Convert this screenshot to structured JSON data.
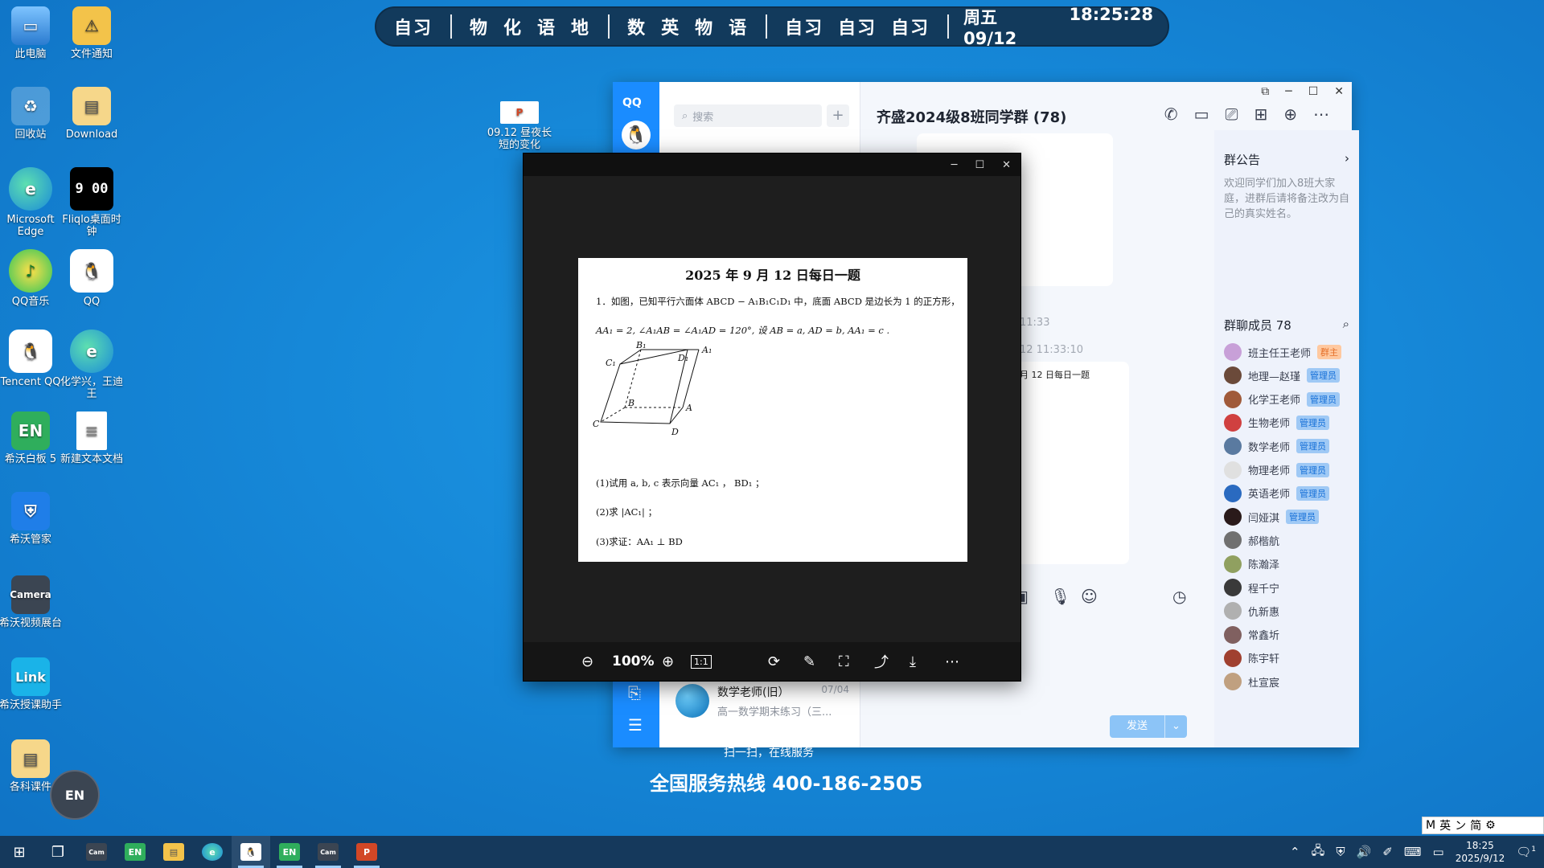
{
  "schedule": {
    "segments": [
      [
        "自习"
      ],
      [
        "物",
        "化",
        "语",
        "地"
      ],
      [
        "数",
        "英",
        "物",
        "语"
      ],
      [
        "自习",
        "自习",
        "自习"
      ]
    ],
    "weekday_date": "周五 09/12",
    "time": "18:25:28"
  },
  "desktop": {
    "icons": [
      {
        "label": "此电脑",
        "icon": "computer-icon"
      },
      {
        "label": "文件通知",
        "icon": "folder-warning-icon"
      },
      {
        "label": "回收站",
        "icon": "recycle-bin-icon"
      },
      {
        "label": "Download",
        "icon": "folder-icon"
      },
      {
        "label": "Microsoft Edge",
        "icon": "edge-icon"
      },
      {
        "label": "Fliqlo桌面时钟",
        "icon": "clock-icon"
      },
      {
        "label": "QQ音乐",
        "icon": "qq-music-icon"
      },
      {
        "label": "QQ",
        "icon": "qq-icon"
      },
      {
        "label": "Tencent QQ",
        "icon": "qq-icon"
      },
      {
        "label": "化学兴，王迪王",
        "icon": "edge-icon"
      },
      {
        "label": "希沃白板 5",
        "icon": "easinote-icon"
      },
      {
        "label": "新建文本文档",
        "icon": "text-document-icon"
      },
      {
        "label": "希沃管家",
        "icon": "shield-icon"
      },
      {
        "label": "希沃视频展台",
        "icon": "camera-icon"
      },
      {
        "label": "希沃授课助手",
        "icon": "link-icon"
      },
      {
        "label": "各科课件",
        "icon": "folder-icon"
      },
      {
        "label": "09.12 昼夜长短的变化",
        "icon": "ppt-icon"
      }
    ],
    "fliqlo_time": "9 00"
  },
  "qq": {
    "brand": "QQ",
    "search_placeholder": "搜索",
    "add_label": "+",
    "chat_list": [
      {
        "name": "数学老师(旧）",
        "time": "07/04",
        "preview": "高一数学期末练习（三..."
      }
    ],
    "chat_title": "齐盛2024级8班同学群 (78)",
    "timestamps": [
      "11:33",
      "12 11:33:10"
    ],
    "bubble_title": "月 12 日每日一题",
    "send_label": "发送",
    "group_notice_title": "群公告",
    "group_notice_text": "欢迎同学们加入8班大家庭，进群后请将备注改为自己的真实姓名。",
    "members_title": "群聊成员 78",
    "members": [
      {
        "name": "班主任王老师",
        "badge": "群主",
        "badge_type": "owner",
        "color": "#c8a0d8"
      },
      {
        "name": "地理—赵瑾",
        "badge": "管理员",
        "badge_type": "admin",
        "color": "#6b4a3a"
      },
      {
        "name": "化学王老师",
        "badge": "管理员",
        "badge_type": "admin",
        "color": "#a05a3a"
      },
      {
        "name": "生物老师",
        "badge": "管理员",
        "badge_type": "admin",
        "color": "#d04040"
      },
      {
        "name": "数学老师",
        "badge": "管理员",
        "badge_type": "admin",
        "color": "#5a7aa0"
      },
      {
        "name": "物理老师",
        "badge": "管理员",
        "badge_type": "admin",
        "color": "#e0e0e0"
      },
      {
        "name": "英语老师",
        "badge": "管理员",
        "badge_type": "admin",
        "color": "#2a6ac0"
      },
      {
        "name": "闫娅淇",
        "badge": "管理员",
        "badge_type": "admin",
        "color": "#2a1a1a"
      },
      {
        "name": "郝楷航",
        "badge": "",
        "badge_type": "",
        "color": "#707070"
      },
      {
        "name": "陈瀚泽",
        "badge": "",
        "badge_type": "",
        "color": "#90a060"
      },
      {
        "name": "程千宁",
        "badge": "",
        "badge_type": "",
        "color": "#3a3a3a"
      },
      {
        "name": "仇新惠",
        "badge": "",
        "badge_type": "",
        "color": "#b0b0b0"
      },
      {
        "name": "常鑫圻",
        "badge": "",
        "badge_type": "",
        "color": "#806060"
      },
      {
        "name": "陈宇轩",
        "badge": "",
        "badge_type": "",
        "color": "#a04030"
      },
      {
        "name": "杜宣宸",
        "badge": "",
        "badge_type": "",
        "color": "#c0a080"
      }
    ]
  },
  "viewer": {
    "zoom": "100%",
    "ratio_label": "1:1",
    "doc_title": "2025 年 9 月 12 日每日一题",
    "problem_line1": "1．如图，已知平行六面体 ABCD − A₁B₁C₁D₁ 中，底面 ABCD 是边长为 1 的正方形，",
    "problem_line2": "AA₁ = 2, ∠A₁AB = ∠A₁AD = 120°, 设 AB = a, AD = b, AA₁ = c .",
    "q1": "(1)试用 a, b, c 表示向量 AC₁ ， BD₁ ；",
    "q2": "(2)求 |AC₁| ；",
    "q3": "(3)求证：AA₁ ⊥ BD",
    "figure_labels": [
      "B₁",
      "A₁",
      "C₁",
      "D₁",
      "B",
      "A",
      "C",
      "D"
    ]
  },
  "hotline": {
    "small": "扫一扫，在线服务",
    "main": "全国服务热线 400-186-2505"
  },
  "ime": [
    "M",
    "英",
    "ン",
    "简",
    "⚙"
  ],
  "taskbar": {
    "time": "18:25",
    "date": "2025/9/12",
    "notification_count": "1"
  }
}
